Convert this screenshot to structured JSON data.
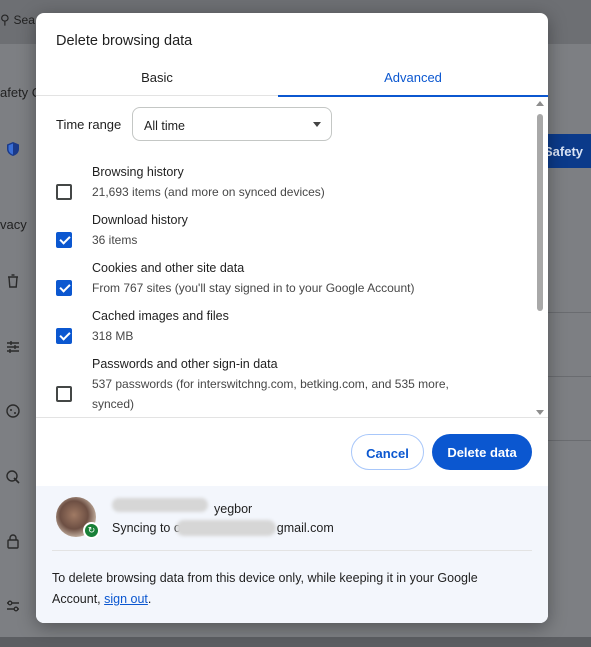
{
  "background": {
    "search_text": "Sea",
    "safety_text": "afety C",
    "privacy_text": "vacy",
    "safety_button": "Safety"
  },
  "dialog": {
    "title": "Delete browsing data",
    "tabs": [
      {
        "label": "Basic",
        "active": false
      },
      {
        "label": "Advanced",
        "active": true
      }
    ],
    "time_range": {
      "label": "Time range",
      "value": "All time"
    },
    "items": [
      {
        "title": "Browsing history",
        "subtitle": "21,693 items (and more on synced devices)",
        "checked": false
      },
      {
        "title": "Download history",
        "subtitle": "36 items",
        "checked": true
      },
      {
        "title": "Cookies and other site data",
        "subtitle": "From 767 sites (you'll stay signed in to your Google Account)",
        "checked": true
      },
      {
        "title": "Cached images and files",
        "subtitle": "318 MB",
        "checked": true
      },
      {
        "title": "Passwords and other sign-in data",
        "subtitle": "537 passwords (for interswitchng.com, betking.com, and 535 more, synced)",
        "checked": false
      }
    ],
    "cancel_label": "Cancel",
    "delete_label": "Delete data"
  },
  "account": {
    "name_visible": "yegbor",
    "sync_prefix": "Syncing to o",
    "sync_suffix": "gmail.com",
    "note_text": "To delete browsing data from this device only, while keeping it in your Google Account,",
    "sign_out": "sign out",
    "note_end": "."
  },
  "colors": {
    "accent": "#0b57d0",
    "sync_badge": "#188038"
  }
}
